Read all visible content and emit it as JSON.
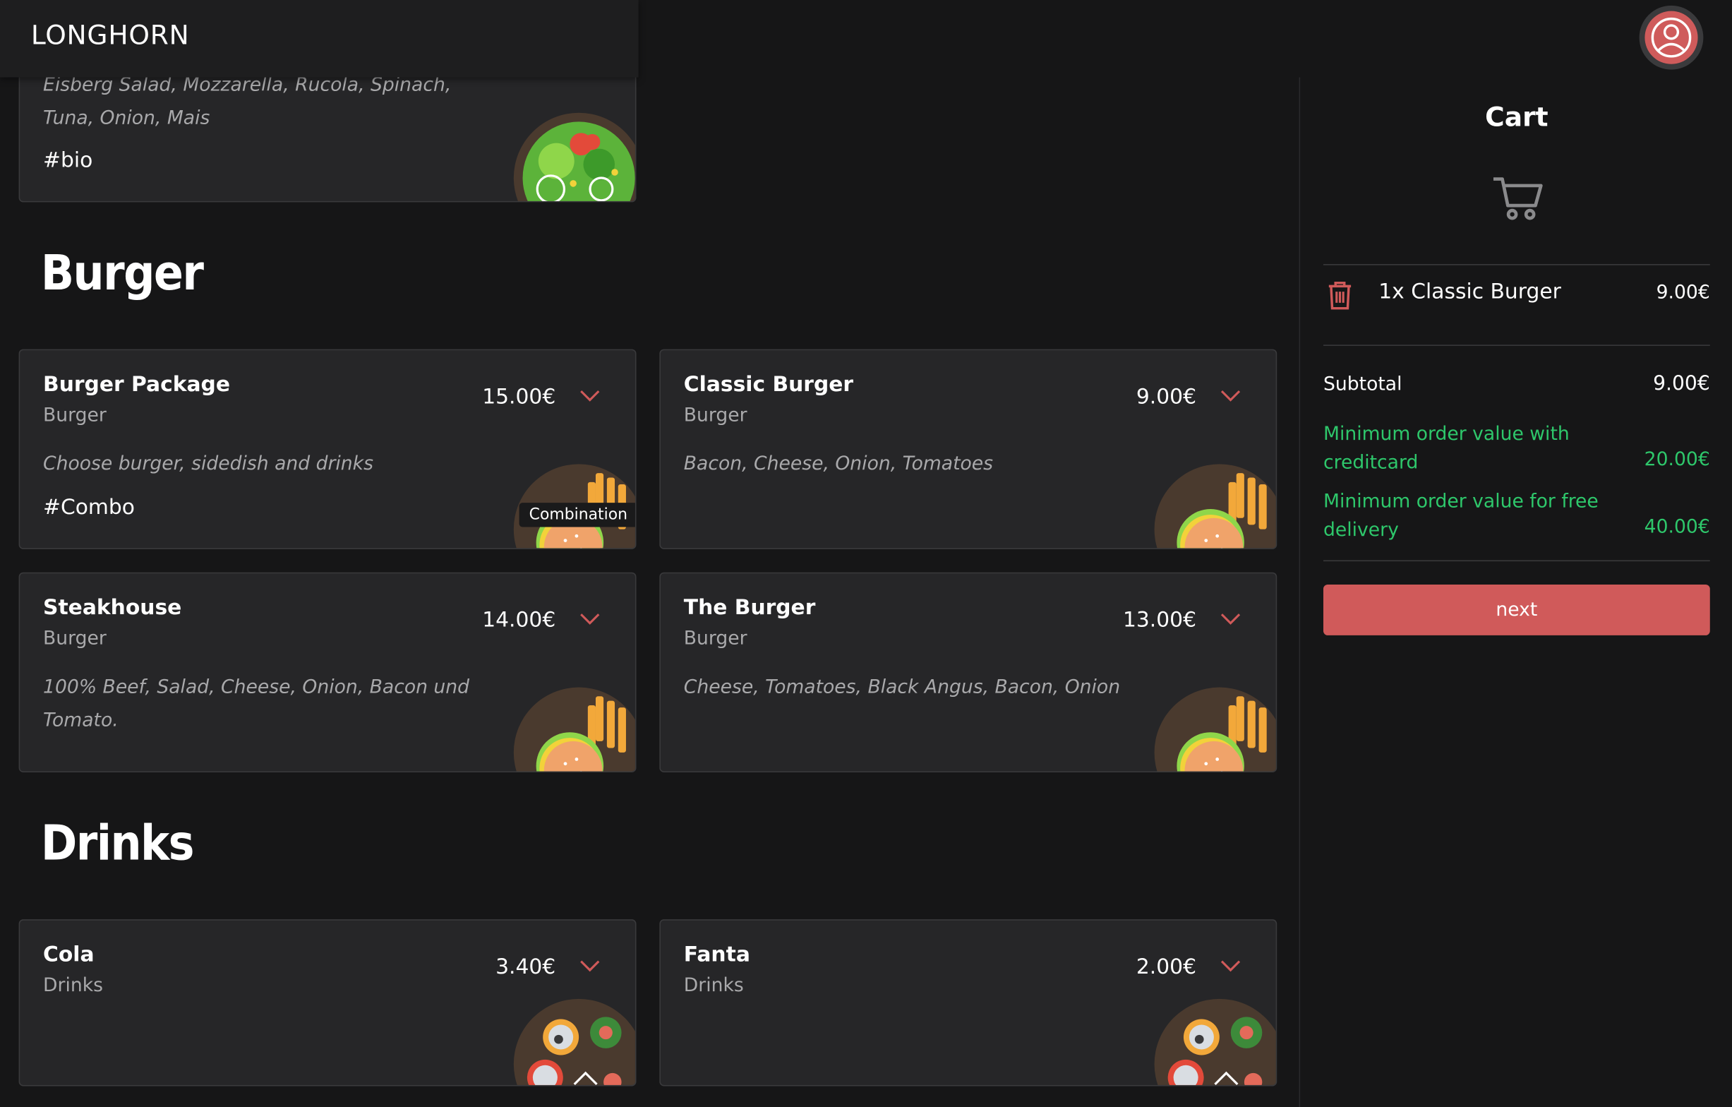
{
  "app": {
    "logo": "LONGHORN"
  },
  "colors": {
    "accent": "#d05a5a",
    "background": "#161617",
    "card": "#262628",
    "green": "#2ec76b"
  },
  "salad": {
    "desc_line1": "Eisberg Salad, Mozzarella, Rucola, Spinach,",
    "desc_line2": "Tuna, Onion, Mais",
    "tag": "#bio"
  },
  "sections": {
    "burger": "Burger",
    "drinks": "Drinks"
  },
  "products": {
    "burger_package": {
      "name": "Burger Package",
      "category": "Burger",
      "price": "15.00€",
      "desc": "Choose burger, sidedish and drinks",
      "tag": "#Combo",
      "badge": "Combination"
    },
    "classic_burger": {
      "name": "Classic Burger",
      "category": "Burger",
      "price": "9.00€",
      "desc": "Bacon, Cheese, Onion, Tomatoes"
    },
    "steakhouse": {
      "name": "Steakhouse",
      "category": "Burger",
      "price": "14.00€",
      "desc_line1": "100% Beef, Salad, Cheese, Onion, Bacon und",
      "desc_line2": "Tomato."
    },
    "the_burger": {
      "name": "The Burger",
      "category": "Burger",
      "price": "13.00€",
      "desc": "Cheese, Tomatoes, Black Angus, Bacon, Onion"
    },
    "cola": {
      "name": "Cola",
      "category": "Drinks",
      "price": "3.40€"
    },
    "fanta": {
      "name": "Fanta",
      "category": "Drinks",
      "price": "2.00€"
    }
  },
  "cart": {
    "title": "Cart",
    "items": [
      {
        "label": "1x Classic Burger",
        "price": "9.00€"
      }
    ],
    "subtotal_label": "Subtotal",
    "subtotal_value": "9.00€",
    "min_card_label": "Minimum order value with creditcard",
    "min_card_value": "20.00€",
    "min_free_label": "Minimum order value for free delivery",
    "min_free_value": "40.00€",
    "next_label": "next"
  },
  "icons": [
    "user-icon",
    "chevron-down-icon",
    "cart-icon",
    "trash-icon"
  ]
}
